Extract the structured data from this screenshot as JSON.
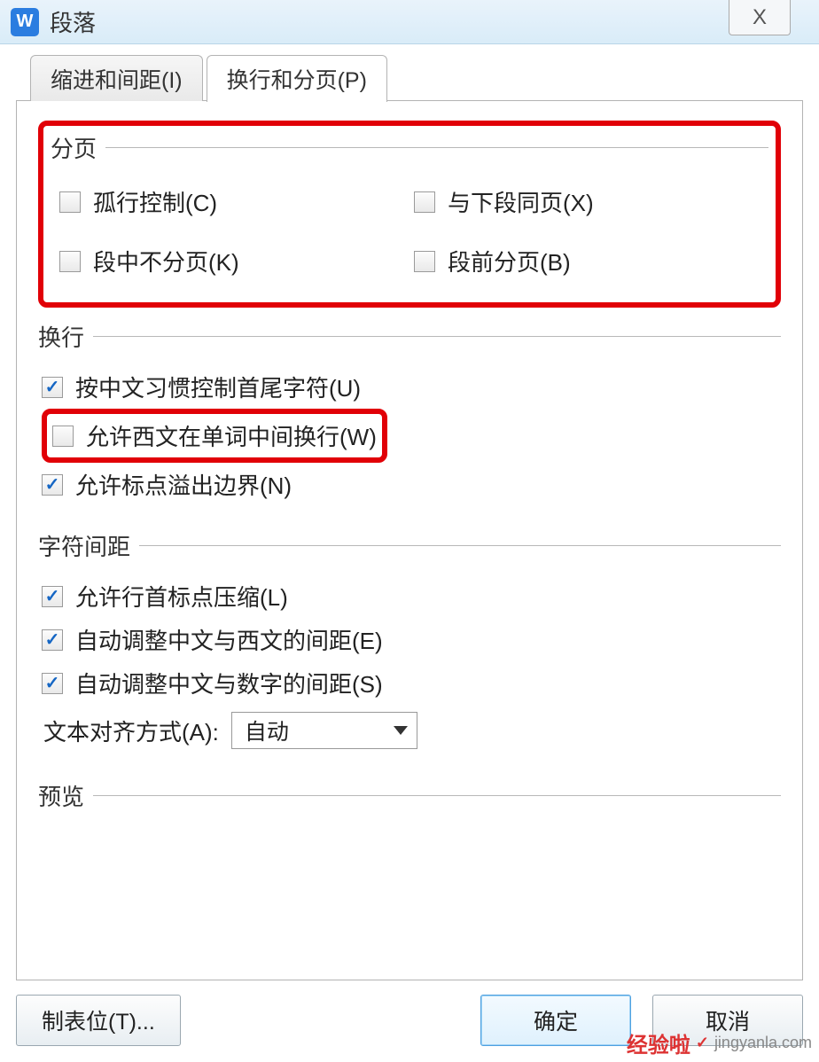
{
  "window": {
    "title": "段落",
    "icon_letter": "W",
    "close_glyph": "X"
  },
  "tabs": {
    "indent": "缩进和间距(I)",
    "pagination": "换行和分页(P)"
  },
  "pagination_group": {
    "legend": "分页",
    "orphan": {
      "label": "孤行控制(C)",
      "checked": false
    },
    "keep_with_next": {
      "label": "与下段同页(X)",
      "checked": false
    },
    "keep_together": {
      "label": "段中不分页(K)",
      "checked": false
    },
    "page_break_before": {
      "label": "段前分页(B)",
      "checked": false
    }
  },
  "linebreak_group": {
    "legend": "换行",
    "cjk_first_last": {
      "label": "按中文习惯控制首尾字符(U)",
      "checked": true
    },
    "latin_word_wrap": {
      "label": "允许西文在单词中间换行(W)",
      "checked": false
    },
    "punct_overflow": {
      "label": "允许标点溢出边界(N)",
      "checked": true
    }
  },
  "char_spacing_group": {
    "legend": "字符间距",
    "compress_punct": {
      "label": "允许行首标点压缩(L)",
      "checked": true
    },
    "space_cn_en": {
      "label": "自动调整中文与西文的间距(E)",
      "checked": true
    },
    "space_cn_num": {
      "label": "自动调整中文与数字的间距(S)",
      "checked": true
    },
    "align_label": "文本对齐方式(A):",
    "align_value": "自动"
  },
  "preview_group": {
    "legend": "预览"
  },
  "buttons": {
    "tabs": "制表位(T)...",
    "ok": "确定",
    "cancel": "取消"
  },
  "watermark": {
    "brand": "经验啦",
    "check": "✓",
    "site": "jingyanla.com"
  }
}
